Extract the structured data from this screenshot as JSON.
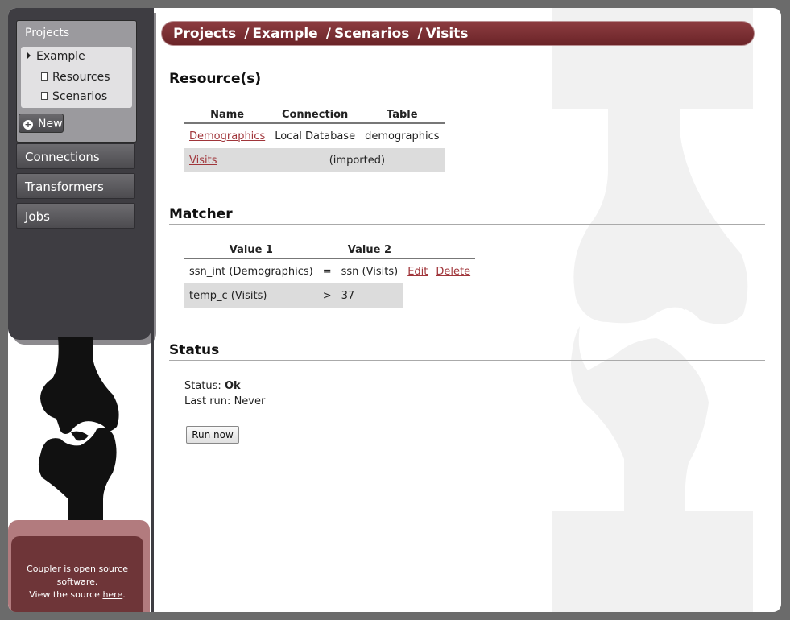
{
  "sidebar": {
    "projects_title": "Projects",
    "tree": [
      {
        "label": "Example",
        "type": "project"
      },
      {
        "label": "Resources",
        "type": "page"
      },
      {
        "label": "Scenarios",
        "type": "page"
      }
    ],
    "new_label": "New",
    "nav": [
      "Connections",
      "Transformers",
      "Jobs"
    ],
    "footer": {
      "line1": "Coupler is open source",
      "line2": "software.",
      "line3_prefix": "View the source ",
      "line3_link": "here",
      "line3_suffix": "."
    }
  },
  "breadcrumb": [
    "Projects",
    "Example",
    "Scenarios",
    "Visits"
  ],
  "resources": {
    "heading": "Resource(s)",
    "columns": [
      "Name",
      "Connection",
      "Table"
    ],
    "rows": [
      {
        "name": "Demographics",
        "connection": "Local Database",
        "table": "demographics"
      },
      {
        "name": "Visits",
        "connection": "(imported)",
        "table": ""
      }
    ]
  },
  "matcher": {
    "heading": "Matcher",
    "columns": [
      "Value 1",
      "Value 2"
    ],
    "rows": [
      {
        "value1": "ssn_int (Demographics)",
        "op": "=",
        "value2": "ssn (Visits)",
        "edit": "Edit",
        "delete": "Delete"
      },
      {
        "value1": "temp_c (Visits)",
        "op": ">",
        "value2": "37"
      }
    ]
  },
  "status": {
    "heading": "Status",
    "status_label": "Status:",
    "status_value": "Ok",
    "last_run_label": "Last run:",
    "last_run_value": "Never",
    "run_button": "Run now"
  },
  "colors": {
    "accent": "#7a2f33",
    "sidebar": "#3e3d42",
    "link": "#a0353a"
  }
}
